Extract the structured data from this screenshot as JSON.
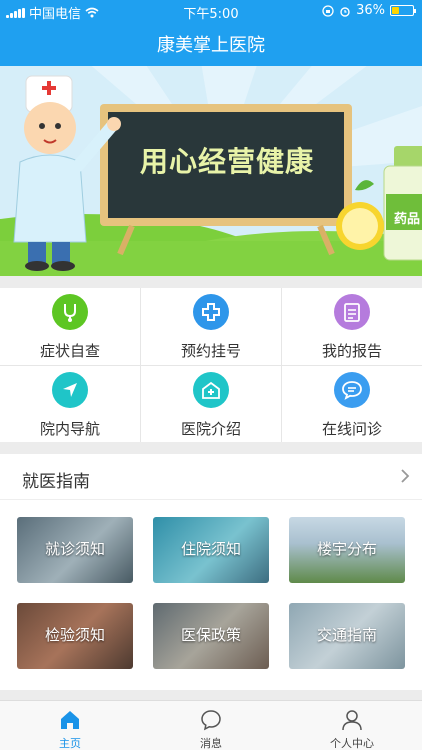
{
  "status_bar": {
    "carrier": "中国电信",
    "time": "下午5:00",
    "battery": "36%",
    "battery_level": 0.36
  },
  "header": {
    "title": "康美掌上医院"
  },
  "banner": {
    "board_text": "用心经营健康",
    "bottle_label": "药品"
  },
  "services": [
    {
      "label": "症状自查",
      "icon": "stethoscope-icon",
      "color": "#5dc623"
    },
    {
      "label": "预约挂号",
      "icon": "medical-cross-icon",
      "color": "#2e96ea"
    },
    {
      "label": "我的报告",
      "icon": "report-icon",
      "color": "#b57bdd"
    },
    {
      "label": "院内导航",
      "icon": "navigation-arrow-icon",
      "color": "#1fc5c8"
    },
    {
      "label": "医院介绍",
      "icon": "hospital-icon",
      "color": "#1fc5c8"
    },
    {
      "label": "在线问诊",
      "icon": "chat-bubble-icon",
      "color": "#3a9df0"
    }
  ],
  "guide": {
    "title": "就医指南",
    "cards": [
      {
        "label": "就诊须知"
      },
      {
        "label": "住院须知"
      },
      {
        "label": "楼宇分布"
      },
      {
        "label": "检验须知"
      },
      {
        "label": "医保政策"
      },
      {
        "label": "交通指南"
      }
    ]
  },
  "tabs": [
    {
      "label": "主页",
      "icon": "home-icon"
    },
    {
      "label": "消息",
      "icon": "message-icon"
    },
    {
      "label": "个人中心",
      "icon": "person-icon"
    }
  ],
  "colors": {
    "primary": "#1fa0f0",
    "tab_active": "#1a93e8"
  }
}
